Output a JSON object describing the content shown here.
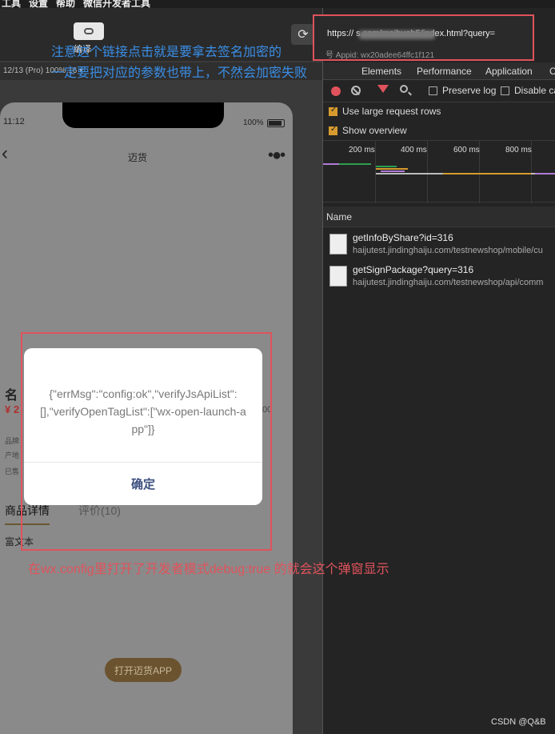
{
  "menubar": {
    "items": [
      "工具",
      "设置",
      "帮助",
      "微信开发者工具"
    ]
  },
  "toolbar": {
    "compile_label": "编译",
    "refresh_icon": "refresh-icon"
  },
  "device": {
    "info": "12/13 (Pro) 100% 16 ▾"
  },
  "phone": {
    "time": "11:12",
    "battery": "100%",
    "nav_title": "迈货",
    "back_icon": "chevron-left-icon",
    "menu_icon": "more-dots-icon",
    "name_partial": "名",
    "price_partial": "¥ 2",
    "sales_partial": "00",
    "rows_partial": [
      "品牌",
      "产地",
      "已售"
    ],
    "tab_detail": "商品详情",
    "tab_reviews": "评价(10)",
    "rich_text": "富文本",
    "open_app": "打开迈货APP"
  },
  "modal": {
    "body": "{\"errMsg\":\"config:ok\",\"verifyJsApiList\":[],\"verifyOpenTagList\":[\"wx-open-launch-app\"]}",
    "ok_label": "确定"
  },
  "devtools": {
    "url": "https://                    s.com/maihuoh5/index.html?query=",
    "appid": "号 Appid: wx20adee64ffc1f121",
    "tabs": [
      "Elements",
      "Performance",
      "Application",
      "C"
    ],
    "preserve_log": "Preserve log",
    "disable_cache": "Disable ca",
    "use_large_rows": "Use large request rows",
    "show_overview": "Show overview",
    "ticks": [
      "200 ms",
      "400 ms",
      "600 ms",
      "800 ms"
    ],
    "name_header": "Name",
    "requests": [
      {
        "name": "getInfoByShare?id=316",
        "url": "haijutest.jindinghaiju.com/testnewshop/mobile/cu"
      },
      {
        "name": "getSignPackage?query=316",
        "url": "haijutest.jindinghaiju.com/testnewshop/api/comm"
      }
    ]
  },
  "annotations": {
    "top_line1": "注意这个链接点击就是要拿去签名加密的",
    "top_line2": "一定要把对应的参数也带上，不然会加密失败",
    "bottom": "在wx.config里打开了开发者模式debug:true 的就会这个弹窗显示"
  },
  "watermark": "CSDN @Q&B",
  "colors": {
    "annotation_blue": "#3a8ee6",
    "annotation_red": "#e0535c",
    "modal_ok": "#3b4e7e"
  }
}
